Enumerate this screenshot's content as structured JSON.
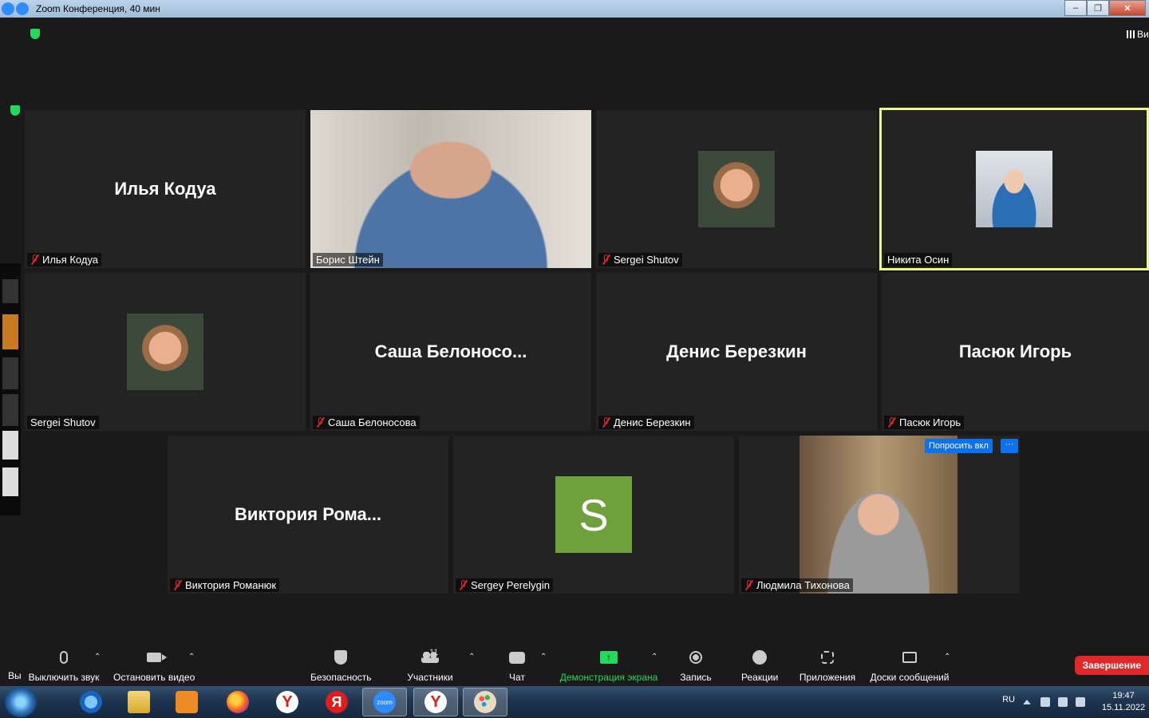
{
  "window": {
    "title": "Zoom Конференция, 40 мин",
    "buttons": {
      "minimize": "–",
      "restore": "❐",
      "close": "✕"
    }
  },
  "view_button": {
    "label": "Ви"
  },
  "participants": [
    {
      "display_name": "Илья Кодуа",
      "label": "Илья Кодуа",
      "muted": true,
      "media": "name"
    },
    {
      "display_name": "",
      "label": "Борис Штейн",
      "muted": false,
      "media": "video"
    },
    {
      "display_name": "",
      "label": "Sergei Shutov",
      "muted": true,
      "media": "avatar-photo"
    },
    {
      "display_name": "",
      "label": "Никита Осин",
      "muted": false,
      "media": "avatar-photo",
      "active_speaker": true
    },
    {
      "display_name": "",
      "label": "Sergei Shutov",
      "muted": false,
      "media": "avatar-photo"
    },
    {
      "display_name": "Саша  Белоносо...",
      "label": "Саша Белоносова",
      "muted": true,
      "media": "name"
    },
    {
      "display_name": "Денис Березкин",
      "label": "Денис Березкин",
      "muted": true,
      "media": "name"
    },
    {
      "display_name": "Пасюк Игорь",
      "label": "Пасюк Игорь",
      "muted": true,
      "media": "name"
    },
    {
      "display_name": "Виктория  Рома...",
      "label": "Виктория Романюк",
      "muted": true,
      "media": "name"
    },
    {
      "display_name": "",
      "label": "Sergey Perelygin",
      "muted": true,
      "media": "letter",
      "letter": "S",
      "letter_color": "#6ea03c"
    },
    {
      "display_name": "",
      "label": "Людмила Тихонова",
      "muted": true,
      "media": "video"
    }
  ],
  "tile_actions": {
    "ask_unmute": "Попросить вкл",
    "more": "···"
  },
  "toolbar": {
    "left_cut": "Вы",
    "mute": "Выключить звук",
    "stop_video": "Остановить видео",
    "security": "Безопасность",
    "participants": "Участники",
    "participants_count": "11",
    "chat": "Чат",
    "share": "Демонстрация экрана",
    "record": "Запись",
    "reactions": "Реакции",
    "apps": "Приложения",
    "whiteboards": "Доски сообщений",
    "end": "Завершение",
    "caret": "⌃"
  },
  "taskbar": {
    "apps": [
      "internet-explorer",
      "file-explorer",
      "media-player",
      "firefox",
      "yandex-browser",
      "yandex",
      "zoom",
      "yandex-browser",
      "paint"
    ],
    "zoom_label": "zoom",
    "yandex_label": "Y",
    "yandex2_label": "Я",
    "language": "RU",
    "time": "19:47",
    "date": "15.11.2022"
  },
  "colors": {
    "active_speaker": "#ecf78a",
    "accent": "#0e72ed",
    "end": "#e02828",
    "share": "#23d959",
    "muted": "#e0242b"
  }
}
